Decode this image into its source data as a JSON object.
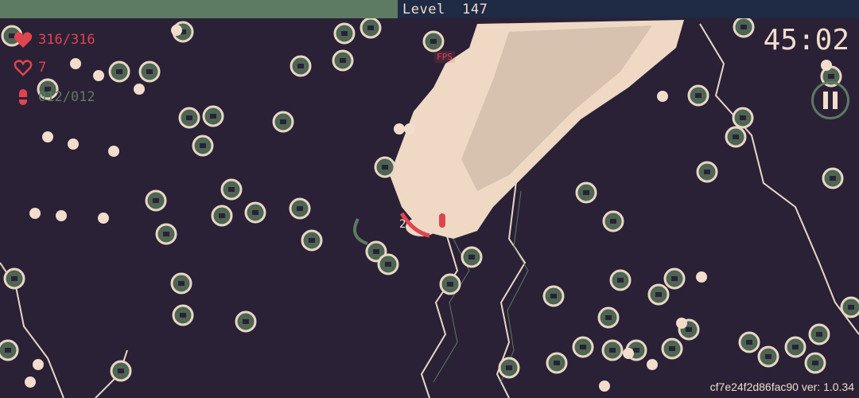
{
  "hud": {
    "level_label": "Level",
    "level_value": "147",
    "xp_fraction": 0.463,
    "hp_text": "316/316",
    "shield_text": "7",
    "ammo_text": "012/012",
    "timer": "45:02",
    "fps_text": "FPS",
    "build_text": "cf7e24f2d86fac90 ver: 1.0.34",
    "damage_number": "2"
  },
  "icons": {
    "hp": "heart-icon",
    "shield": "heart-outline-icon",
    "ammo": "bullet-icon",
    "pause": "pause-icon"
  },
  "colors": {
    "background": "#2a2136",
    "cream": "#f2dccb",
    "enemy_fill": "#4d6552",
    "enemy_outline": "#e8d6c4",
    "accent_red": "#e0454f",
    "xp_green": "#5d7a62",
    "xp_bar_bg": "#1f2a44"
  }
}
